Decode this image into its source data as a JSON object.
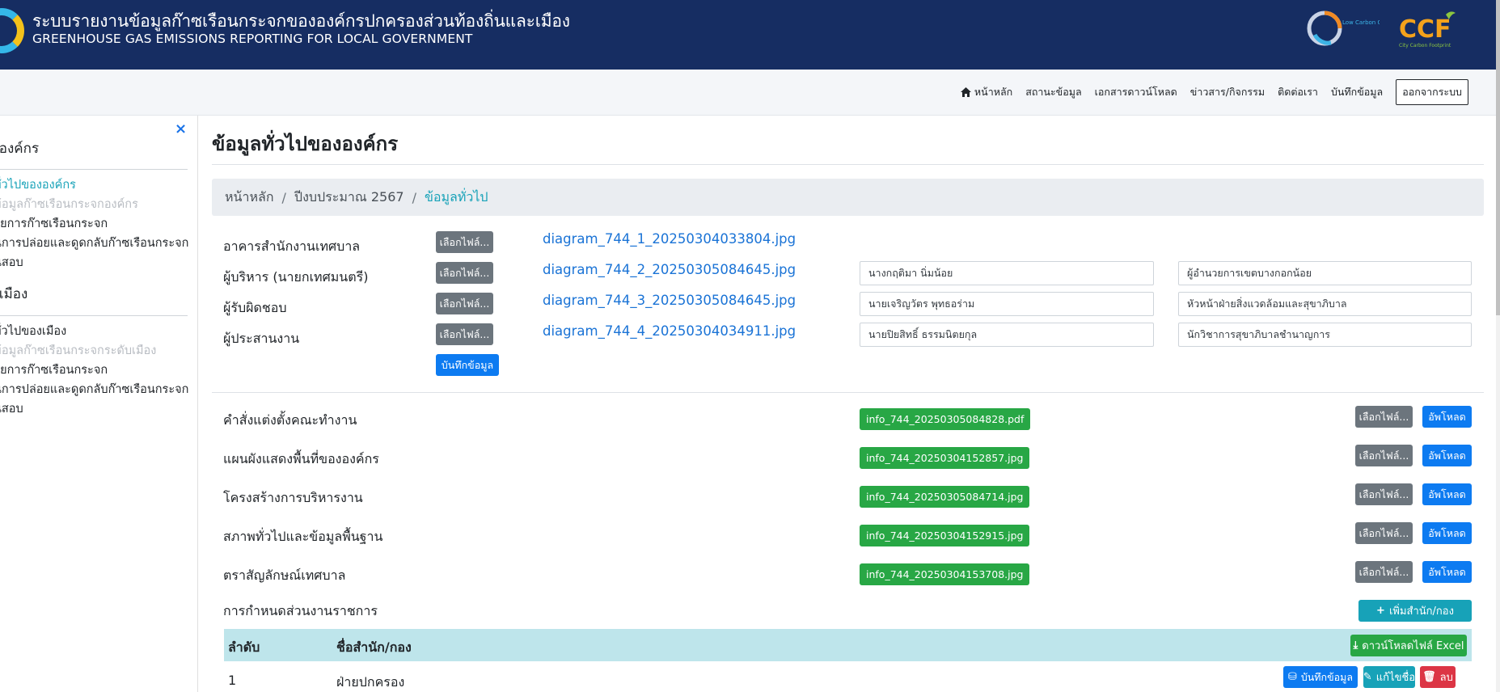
{
  "header": {
    "title_th": "ระบบรายงานข้อมูลก๊าซเรือนกระจกขององค์กรปกครองส่วนท้องถิ่นและเมือง",
    "title_en": "GREENHOUSE GAS EMISSIONS REPORTING FOR LOCAL GOVERNMENT",
    "logo_low_text": "Low Carbon Organization",
    "logo_ccf_text": "CCF",
    "logo_ccf_sub": "City Carbon Footprint"
  },
  "nav": {
    "items": [
      "หน้าหลัก",
      "สถานะข้อมูล",
      "เอกสารดาวน์โหลด",
      "ข่าวสาร/กิจกรรม",
      "ติดต่อเรา",
      "บันทึกข้อมูล"
    ],
    "logout": "ออกจากระบบ"
  },
  "sidebar": {
    "close": "×",
    "section1_title": "ับองค์กร",
    "section1_items": [
      "ทั่วไปขององค์กร",
      "ข้อมูลก๊าซเรือนกระจกองค์กร",
      "ายการก๊าซเรือนกระจก",
      "นการปล่อยและดูดกลับก๊าซเรือนกระจก",
      "นสอบ"
    ],
    "section2_title": "ับเมือง",
    "section2_items": [
      "ทั่วไปของเมือง",
      "ข้อมูลก๊าซเรือนกระจกระดับเมือง",
      "ายการก๊าซเรือนกระจก",
      "นการปล่อยและดูดกลับก๊าซเรือนกระจก",
      "นสอบ"
    ]
  },
  "main": {
    "title": "ข้อมูลทั่วไปขององค์กร",
    "breadcrumb": [
      "หน้าหลัก",
      "ปีงบประมาณ 2567",
      "ข้อมูลทั่วไป"
    ],
    "choose_file": "เลือกไฟล์...",
    "save": "บันทึกข้อมูล",
    "photo_rows": [
      {
        "label": "อาคารสำนักงานเทศบาล",
        "file": "diagram_744_1_20250304033804.jpg",
        "name": "",
        "position": ""
      },
      {
        "label": "ผู้บริหาร (นายกเทศมนตรี)",
        "file": "diagram_744_2_20250305084645.jpg",
        "name": "นางกฤติมา  นิ่มน้อย",
        "position": "ผู้อำนวยการเขตบางกอกน้อย"
      },
      {
        "label": "ผู้รับผิดชอบ",
        "file": "diagram_744_3_20250305084645.jpg",
        "name": "นายเจริญวัตร  พุทธอร่าม",
        "position": "หัวหน้าฝ่ายสิ่งแวดล้อมและสุขาภิบาล"
      },
      {
        "label": "ผู้ประสานงาน",
        "file": "diagram_744_4_20250304034911.jpg",
        "name": "นายปิยสิทธิ์  ธรรมนิตยกุล",
        "position": "นักวิชาการสุขาภิบาลชำนาญการ"
      }
    ],
    "upload": "อัพโหลด",
    "doc_rows": [
      {
        "label": "คำสั่งแต่งตั้งคณะทำงาน",
        "file": "info_744_20250305084828.pdf"
      },
      {
        "label": "แผนผังแสดงพื้นที่ขององค์กร",
        "file": "info_744_20250304152857.jpg"
      },
      {
        "label": "โครงสร้างการบริหารงาน",
        "file": "info_744_20250305084714.jpg"
      },
      {
        "label": "สภาพทั่วไปและข้อมูลพื้นฐาน",
        "file": "info_744_20250304152915.jpg"
      },
      {
        "label": "ตราสัญลักษณ์เทศบาล",
        "file": "info_744_20250304153708.jpg"
      }
    ],
    "units_title": "การกำหนดส่วนงานราชการ",
    "add_unit": "เพิ่มสำนัก/กอง",
    "table": {
      "col_no": "ลำดับ",
      "col_name": "ชื่อสำนัก/กอง",
      "download_excel": "ดาวน์โหลดไฟล์ Excel",
      "rows": [
        {
          "no": "1",
          "name": "ฝ่ายปกครอง"
        }
      ],
      "btn_save": "บันทึกข้อมูล",
      "btn_edit": "แก้ไขชื่อ",
      "btn_delete": "ลบ"
    }
  },
  "colors": {
    "header_bg": "#162d62",
    "accent_teal": "#17a2b8",
    "primary_blue": "#0d7bf1",
    "success_green": "#28a745",
    "danger_red": "#dc3545"
  }
}
